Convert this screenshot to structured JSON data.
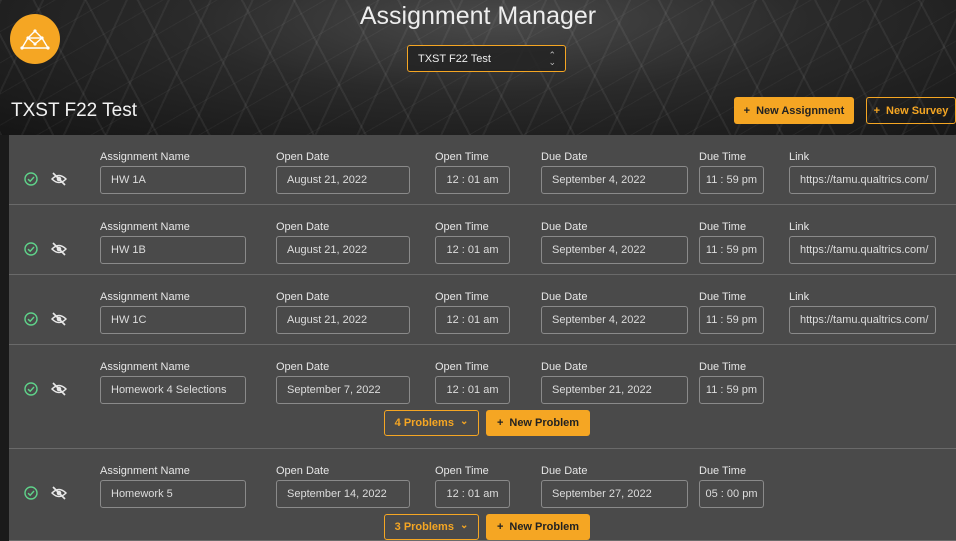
{
  "header": {
    "app_title": "Assignment Manager",
    "course_select_value": "TXST F22 Test",
    "course_title": "TXST F22 Test",
    "new_assignment_label": "New Assignment",
    "new_survey_label": "New Survey",
    "brand_color": "#f5a623"
  },
  "labels": {
    "assignment_name": "Assignment Name",
    "open_date": "Open Date",
    "open_time": "Open Time",
    "due_date": "Due Date",
    "due_time": "Due Time",
    "link": "Link",
    "new_problem": "New Problem"
  },
  "assignments": [
    {
      "name": "HW 1A",
      "open_date": "August 21, 2022",
      "open_time": "12 : 01 am",
      "due_date": "September 4, 2022",
      "due_time": "11 : 59 pm",
      "link": "https://tamu.qualtrics.com/"
    },
    {
      "name": "HW 1B",
      "open_date": "August 21, 2022",
      "open_time": "12 : 01 am",
      "due_date": "September 4, 2022",
      "due_time": "11 : 59 pm",
      "link": "https://tamu.qualtrics.com/"
    },
    {
      "name": "HW 1C",
      "open_date": "August 21, 2022",
      "open_time": "12 : 01 am",
      "due_date": "September 4, 2022",
      "due_time": "11 : 59 pm",
      "link": "https://tamu.qualtrics.com/"
    },
    {
      "name": "Homework 4 Selections",
      "open_date": "September 7, 2022",
      "open_time": "12 : 01 am",
      "due_date": "September 21, 2022",
      "due_time": "11 : 59 pm",
      "problems_label": "4 Problems"
    },
    {
      "name": "Homework 5",
      "open_date": "September 14, 2022",
      "open_time": "12 : 01 am",
      "due_date": "September 27, 2022",
      "due_time": "05 : 00 pm",
      "problems_label": "3 Problems"
    }
  ]
}
